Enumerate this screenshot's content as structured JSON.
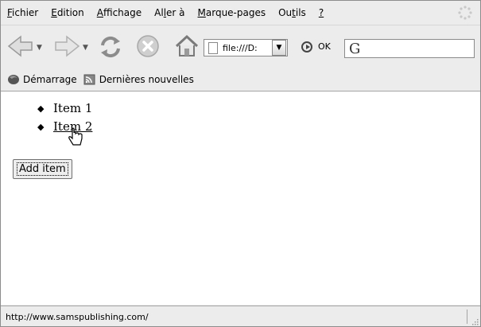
{
  "menubar": {
    "items": [
      {
        "key": "F",
        "rest": "ichier"
      },
      {
        "key": "E",
        "rest": "dition"
      },
      {
        "key": "A",
        "rest": "ffichage"
      },
      {
        "pre": "Al",
        "key": "l",
        "rest": "er à"
      },
      {
        "key": "M",
        "rest": "arque-pages"
      },
      {
        "pre": "Ou",
        "key": "t",
        "rest": "ils"
      },
      {
        "key": "?",
        "rest": ""
      }
    ]
  },
  "toolbar": {
    "back_icon": "back-arrow-icon",
    "forward_icon": "forward-arrow-icon",
    "reload_icon": "reload-icon",
    "stop_icon": "stop-icon",
    "home_icon": "home-icon",
    "url": "file:///D:",
    "go_label": "OK",
    "search_icon": "google-search-icon"
  },
  "bookmarks": {
    "items": [
      {
        "label": "Démarrage",
        "icon": "firefox-icon"
      },
      {
        "label": "Dernières nouvelles",
        "icon": "rss-feed-icon"
      }
    ]
  },
  "content": {
    "items": [
      {
        "label": "Item 1",
        "link": false
      },
      {
        "label": "Item 2",
        "link": true
      }
    ],
    "add_button_label": "Add item"
  },
  "statusbar": {
    "text": "http://www.samspublishing.com/"
  }
}
